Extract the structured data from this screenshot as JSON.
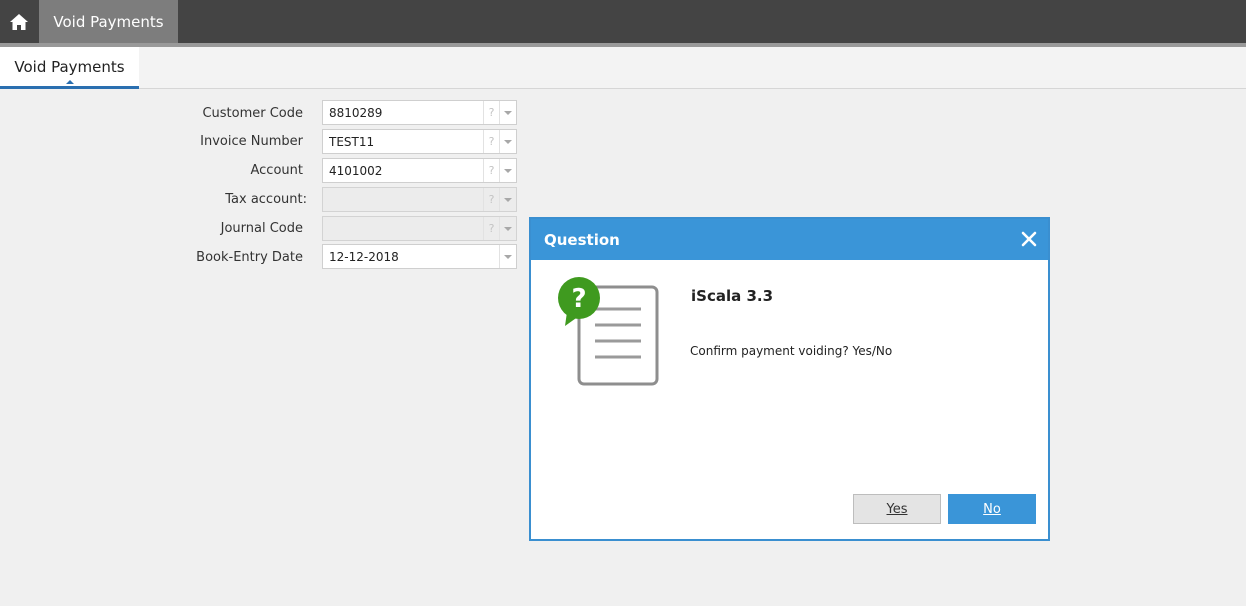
{
  "topbar": {
    "home_icon": "home-icon",
    "active_tab": "Void Payments"
  },
  "subtabs": {
    "active": "Void Payments"
  },
  "form": {
    "fields": [
      {
        "label": "Customer Code",
        "value": "8810289",
        "has_lookup": true,
        "disabled": false
      },
      {
        "label": "Invoice Number",
        "value": "TEST11",
        "has_lookup": true,
        "disabled": false
      },
      {
        "label": "Account",
        "value": "4101002",
        "has_lookup": true,
        "disabled": false
      },
      {
        "label": "Tax account:",
        "value": "",
        "has_lookup": true,
        "disabled": true
      },
      {
        "label": "Journal Code",
        "value": "",
        "has_lookup": true,
        "disabled": true
      },
      {
        "label": "Book-Entry Date",
        "value": "12-12-2018",
        "has_lookup": false,
        "disabled": false
      }
    ],
    "lookup_glyph": "?"
  },
  "dialog": {
    "title": "Question",
    "close_icon": "close-icon",
    "icon": "question-document-icon",
    "app_name": "iScala 3.3",
    "message": "Confirm payment voiding? Yes/No",
    "yes_label": "Yes",
    "no_label": "No",
    "accent_color": "#3a95d8",
    "question_badge_color": "#3f9a1f"
  }
}
